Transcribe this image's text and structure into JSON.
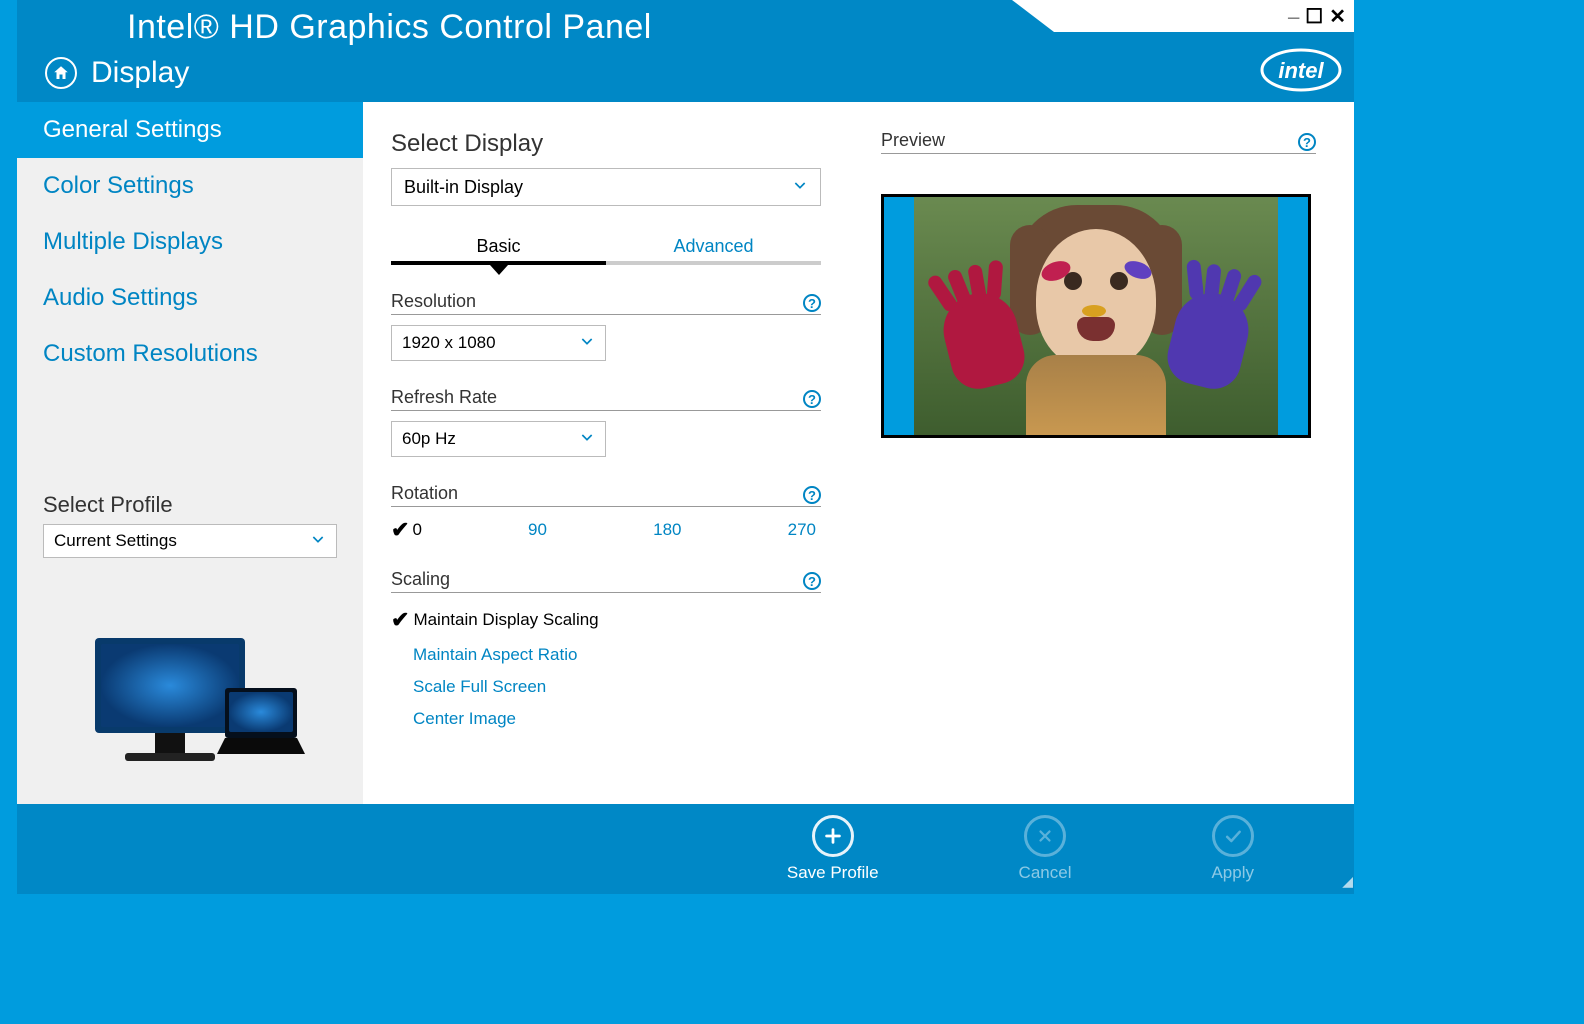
{
  "window": {
    "title": "Intel® HD Graphics Control Panel",
    "breadcrumb": "Display"
  },
  "sidebar": {
    "items": [
      {
        "label": "General Settings",
        "active": true
      },
      {
        "label": "Color Settings",
        "active": false
      },
      {
        "label": "Multiple Displays",
        "active": false
      },
      {
        "label": "Audio Settings",
        "active": false
      },
      {
        "label": "Custom Resolutions",
        "active": false
      }
    ],
    "profile": {
      "label": "Select Profile",
      "value": "Current Settings"
    }
  },
  "main": {
    "select_display_label": "Select Display",
    "select_display_value": "Built-in Display",
    "tabs": {
      "basic": "Basic",
      "advanced": "Advanced"
    },
    "resolution": {
      "label": "Resolution",
      "value": "1920 x 1080"
    },
    "refresh": {
      "label": "Refresh Rate",
      "value": "60p Hz"
    },
    "rotation": {
      "label": "Rotation",
      "options": [
        "0",
        "90",
        "180",
        "270"
      ],
      "selected": "0"
    },
    "scaling": {
      "label": "Scaling",
      "options": [
        "Maintain Display Scaling",
        "Maintain Aspect Ratio",
        "Scale Full Screen",
        "Center Image"
      ],
      "selected": "Maintain Display Scaling"
    },
    "preview_label": "Preview"
  },
  "footer": {
    "save": "Save Profile",
    "cancel": "Cancel",
    "apply": "Apply"
  }
}
